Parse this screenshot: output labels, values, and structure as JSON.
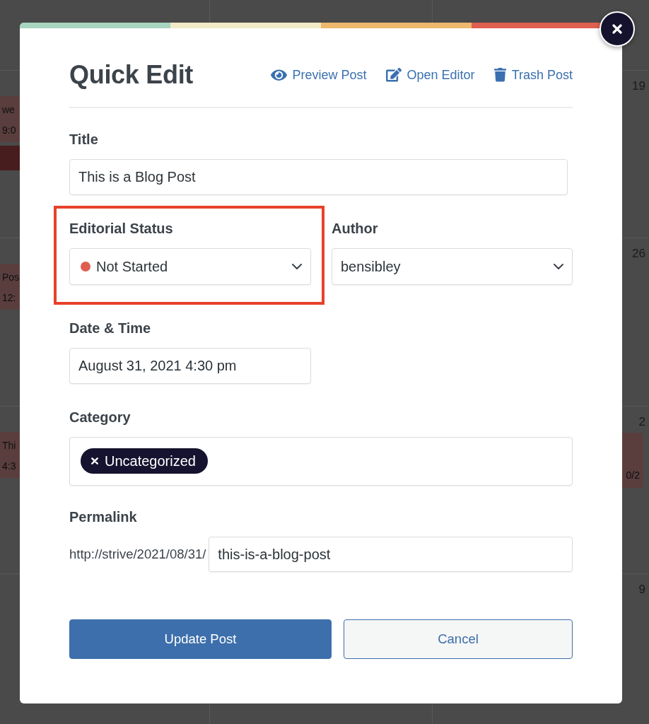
{
  "background_calendar": {
    "rows": [
      {
        "left_events": [
          {
            "kind": "chip",
            "title": "we",
            "time": "9:0"
          },
          {
            "kind": "bar"
          }
        ],
        "day_number": "19"
      },
      {
        "left_events": [
          {
            "kind": "chip",
            "title": "Pos",
            "time": "12:"
          }
        ],
        "day_number": "26"
      },
      {
        "left_events": [
          {
            "kind": "chip",
            "title": "Thi",
            "time": "4:3"
          }
        ],
        "day_number": "2",
        "right_events": [
          {
            "kind": "chip",
            "time": "0/2"
          }
        ]
      },
      {
        "day_number": "9"
      }
    ]
  },
  "quick_edit": {
    "stripe": [
      {
        "color": "#a8d5bf"
      },
      {
        "color": "#f2eac6"
      },
      {
        "color": "#eeb86d"
      },
      {
        "color": "#df5f50"
      }
    ],
    "title": "Quick Edit",
    "actions": [
      {
        "kind": "preview",
        "label": "Preview Post"
      },
      {
        "kind": "edit",
        "label": "Open Editor"
      },
      {
        "kind": "trash",
        "label": "Trash Post"
      }
    ],
    "title_field": {
      "label": "Title",
      "value": "This is a Blog Post"
    },
    "editorial_status": {
      "label": "Editorial Status",
      "value": "Not Started",
      "color": "#dd5f50",
      "highlighted": true
    },
    "author": {
      "label": "Author",
      "value": "bensibley"
    },
    "date_time": {
      "label": "Date & Time",
      "value": "August 31, 2021 4:30 pm"
    },
    "category": {
      "label": "Category",
      "tags": [
        {
          "label": "Uncategorized"
        }
      ]
    },
    "permalink": {
      "label": "Permalink",
      "prefix": "http://strive/2021/08/31/",
      "value": "this-is-a-blog-post"
    },
    "buttons": [
      {
        "kind": "primary",
        "label": "Update Post"
      },
      {
        "kind": "secondary",
        "label": "Cancel"
      }
    ]
  }
}
